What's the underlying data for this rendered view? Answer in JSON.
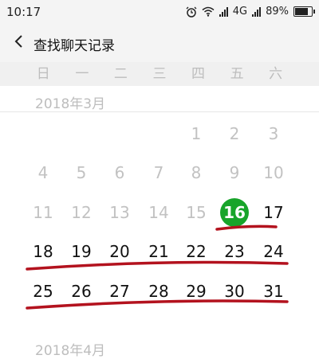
{
  "status_bar": {
    "time": "10:17",
    "icons": [
      "alarm-icon",
      "wifi-icon",
      "signal-icon"
    ],
    "network": "4G",
    "battery": "89%",
    "battery_level": 0.89
  },
  "header": {
    "title": "查找聊天记录",
    "back_icon": "chevron-left-icon"
  },
  "weekdays": [
    "日",
    "一",
    "二",
    "三",
    "四",
    "五",
    "六"
  ],
  "months": [
    {
      "label": "2018年3月",
      "first_weekday": 4,
      "days_in_month": 31,
      "today": 16,
      "weeks": [
        [
          "",
          "",
          "",
          "",
          "1",
          "2",
          "3"
        ],
        [
          "4",
          "5",
          "6",
          "7",
          "8",
          "9",
          "10"
        ],
        [
          "11",
          "12",
          "13",
          "14",
          "15",
          "16",
          "17"
        ],
        [
          "18",
          "19",
          "20",
          "21",
          "22",
          "23",
          "24"
        ],
        [
          "25",
          "26",
          "27",
          "28",
          "29",
          "30",
          "31"
        ]
      ]
    },
    {
      "label": "2018年4月"
    }
  ],
  "colors": {
    "today_bg": "#18a42a",
    "underline": "#b3121e",
    "disabled_text": "#c2c2c2",
    "active_text": "#111111",
    "header_bg": "#f4f4f4"
  }
}
